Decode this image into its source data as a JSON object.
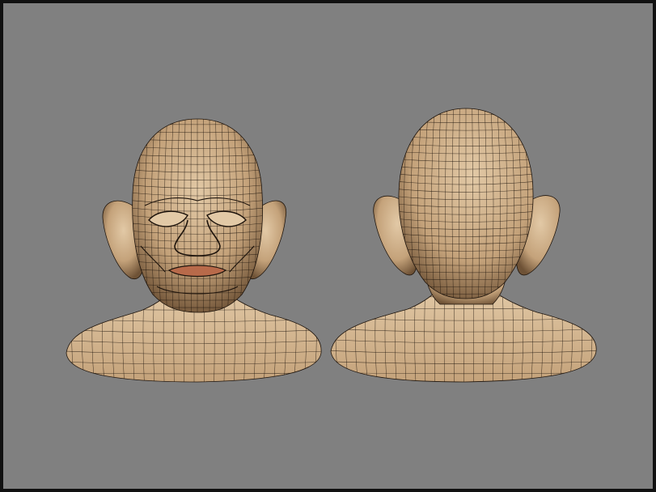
{
  "scene": {
    "background_color": "#808080",
    "frame_color": "#111111",
    "skin_light": "#e2c9a6",
    "skin_mid": "#c4a27a",
    "skin_dark": "#6e5236",
    "wire_color": "#1e140c",
    "lip_color": "#b86a4a",
    "views": [
      {
        "name": "front-view"
      },
      {
        "name": "back-view"
      }
    ]
  }
}
